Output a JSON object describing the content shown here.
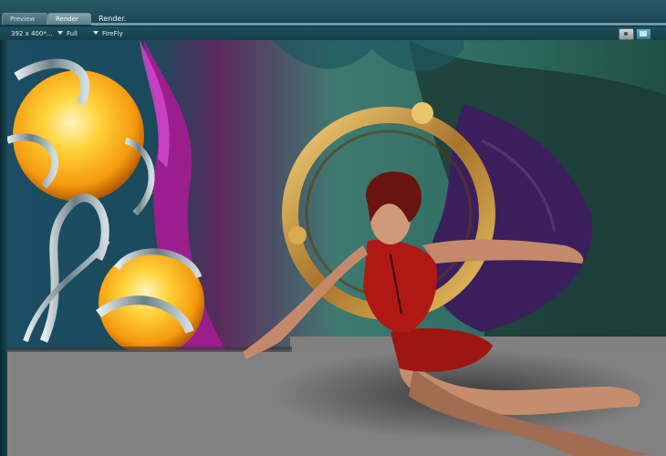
{
  "tabs": {
    "preview_label": "Preview",
    "render_label": "Render"
  },
  "render_title": "Render.",
  "toolbar": {
    "dimensions": "392 x 400*...",
    "size_mode": "Full",
    "renderer": "FireFly"
  },
  "icons": {
    "render_camera": "camera-icon",
    "render_monitor": "monitor-icon"
  },
  "colors": {
    "panel_teal": "#1b4654",
    "floor_gray": "#818181",
    "orb_orange": "#ffb21a",
    "dress_red": "#b01815"
  }
}
